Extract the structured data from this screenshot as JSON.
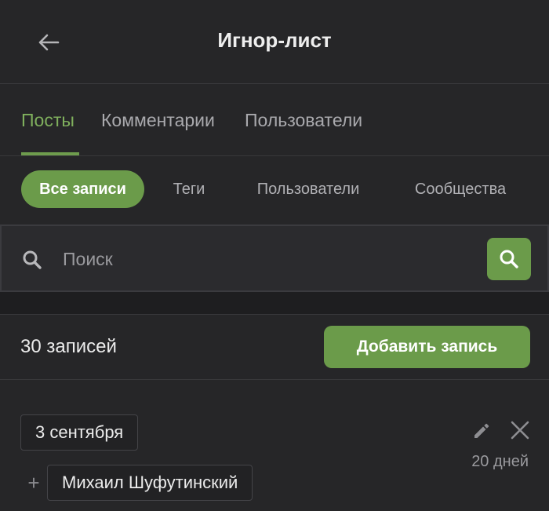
{
  "header": {
    "title": "Игнор-лист",
    "back_icon": "arrow-left-icon"
  },
  "tabs": [
    {
      "label": "Посты",
      "active": true
    },
    {
      "label": "Комментарии",
      "active": false
    },
    {
      "label": "Пользователи",
      "active": false
    }
  ],
  "filters": [
    {
      "label": "Все записи",
      "active": true
    },
    {
      "label": "Теги",
      "active": false
    },
    {
      "label": "Пользователи",
      "active": false
    },
    {
      "label": "Сообщества",
      "active": false
    }
  ],
  "search": {
    "placeholder": "Поиск",
    "value": "",
    "icon": "search-icon"
  },
  "list": {
    "count_text": "30 записей",
    "add_button_label": "Добавить запись"
  },
  "entry": {
    "date": "3 сентября",
    "duration": "20 дней",
    "name": "Михаил Шуфутинский",
    "plus_symbol": "+"
  },
  "colors": {
    "accent": "#6b9b4a",
    "active_tab": "#7faf5d",
    "background": "#262628"
  }
}
